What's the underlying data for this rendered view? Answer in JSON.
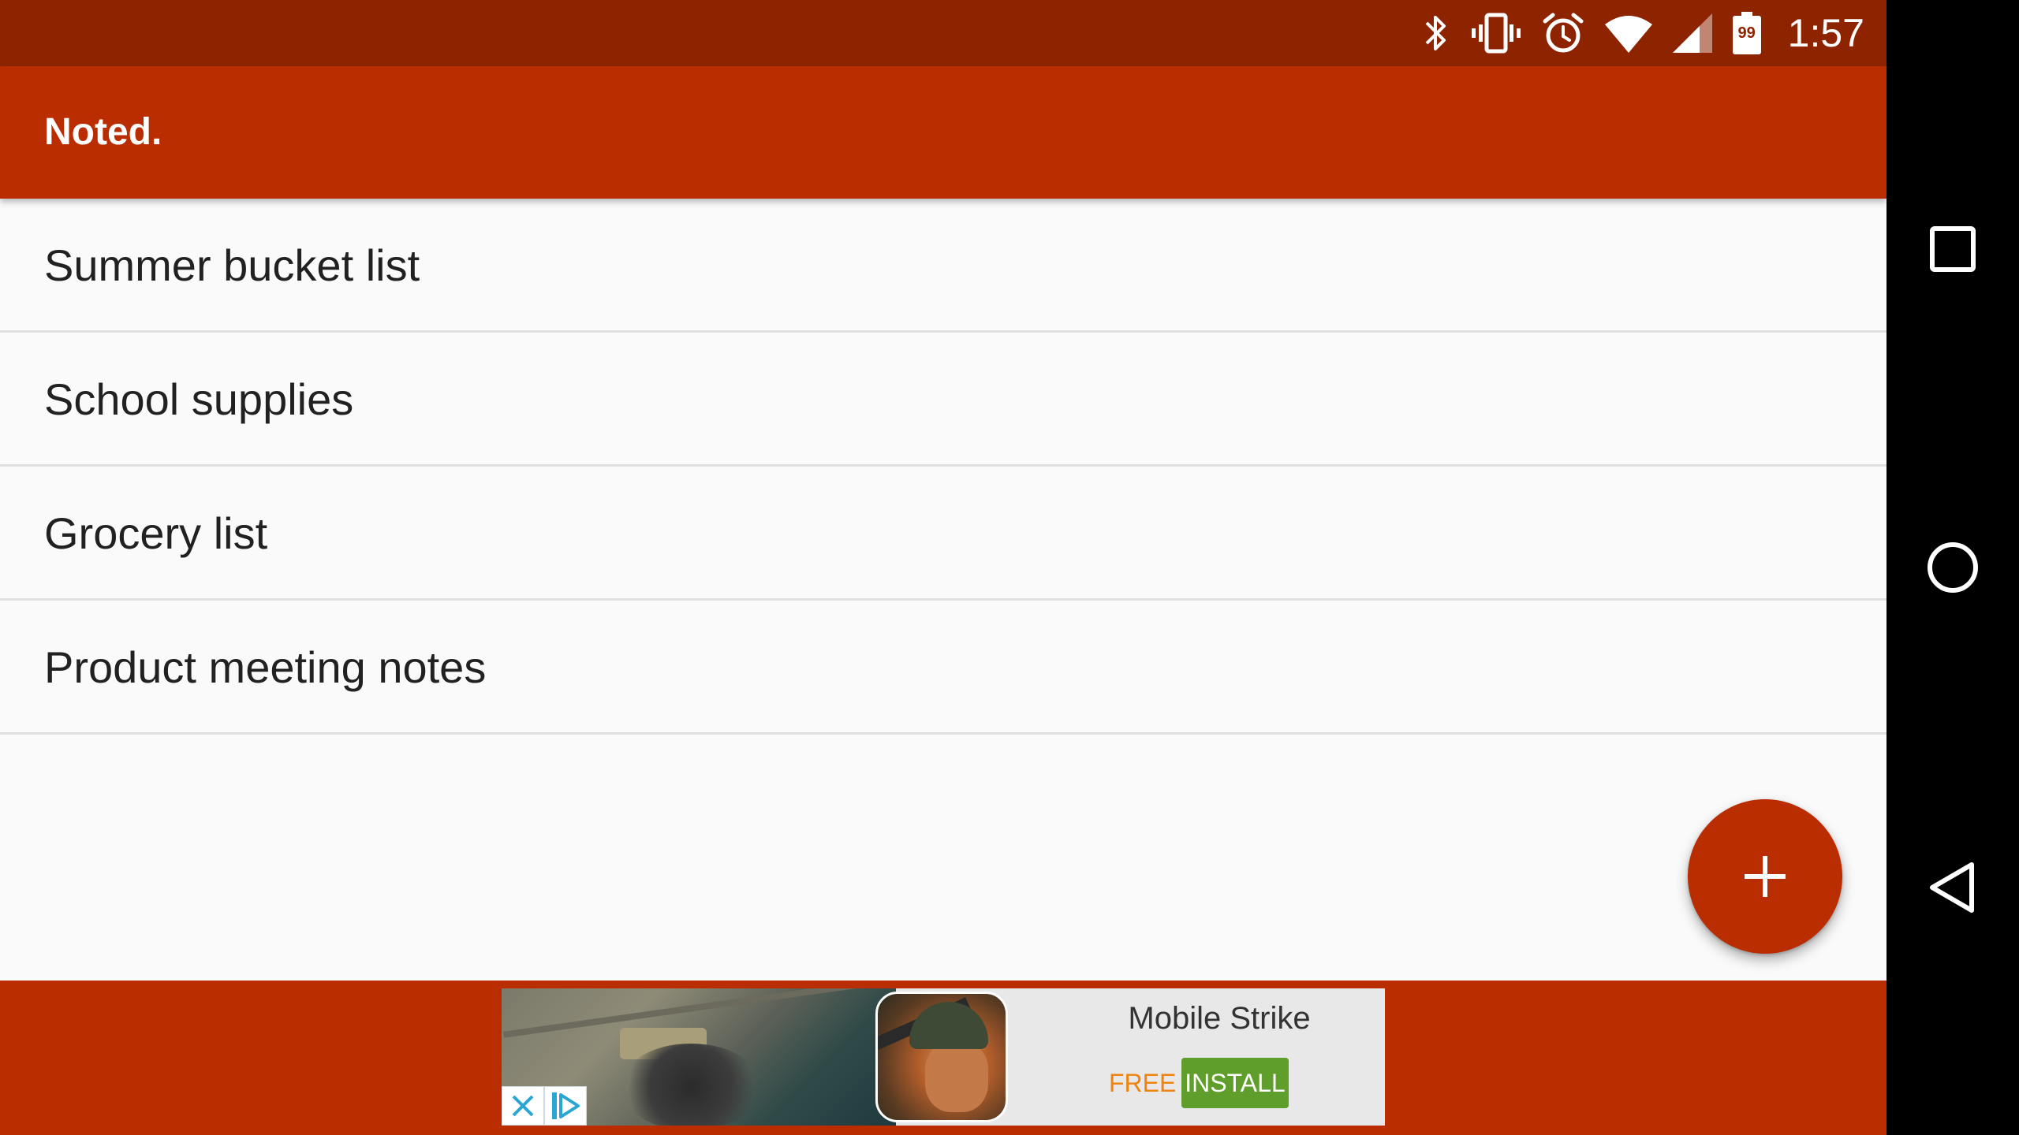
{
  "status_bar": {
    "time": "1:57",
    "battery_level": "99",
    "icons": [
      "bluetooth-icon",
      "vibrate-icon",
      "alarm-icon",
      "wifi-icon",
      "cell-signal-icon",
      "battery-icon"
    ],
    "background_color": "#8e2300"
  },
  "app_bar": {
    "title": "Noted.",
    "background_color": "#ba2d00"
  },
  "notes": [
    {
      "title": "Summer bucket list"
    },
    {
      "title": "School supplies"
    },
    {
      "title": "Grocery list"
    },
    {
      "title": "Product meeting notes"
    }
  ],
  "fab": {
    "icon": "plus-icon",
    "color": "#ba2d00"
  },
  "ad": {
    "title": "Mobile Strike",
    "price_label": "FREE",
    "install_label": "INSTALL",
    "install_color": "#5f9e2b"
  },
  "nav_bar": {
    "icons": [
      "recents-icon",
      "home-icon",
      "back-icon"
    ]
  }
}
